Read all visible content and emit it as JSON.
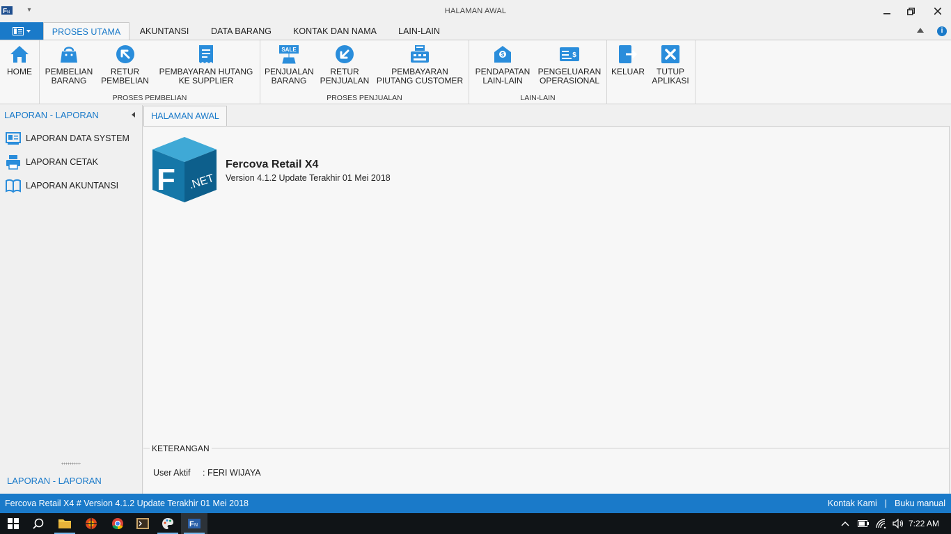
{
  "window": {
    "title": "HALAMAN AWAL",
    "controls": [
      "minimize-icon",
      "restore-icon",
      "close-icon"
    ]
  },
  "ribbon_tabs": [
    "PROSES UTAMA",
    "AKUNTANSI",
    "DATA BARANG",
    "KONTAK DAN NAMA",
    "LAIN-LAIN"
  ],
  "active_tab": "PROSES UTAMA",
  "ribbon_groups": [
    {
      "label": "",
      "buttons": [
        {
          "label": "HOME",
          "icon": "home-icon"
        }
      ]
    },
    {
      "label": "PROSES PEMBELIAN",
      "buttons": [
        {
          "label": "PEMBELIAN\nBARANG",
          "icon": "shopping-bag-icon"
        },
        {
          "label": "RETUR\nPEMBELIAN",
          "icon": "arrow-up-left-icon"
        },
        {
          "label": "PEMBAYARAN HUTANG\nKE SUPPLIER",
          "icon": "receipt-icon"
        }
      ]
    },
    {
      "label": "PROSES PENJUALAN",
      "buttons": [
        {
          "label": "PENJUALAN\nBARANG",
          "icon": "sale-tag-icon"
        },
        {
          "label": "RETUR\nPENJUALAN",
          "icon": "arrow-down-left-icon"
        },
        {
          "label": "PEMBAYARAN\nPIUTANG CUSTOMER",
          "icon": "cash-register-icon"
        }
      ]
    },
    {
      "label": "LAIN-LAIN",
      "buttons": [
        {
          "label": "PENDAPATAN\nLAIN-LAIN",
          "icon": "income-icon"
        },
        {
          "label": "PENGELUARAN\nOPERASIONAL",
          "icon": "cheque-icon"
        }
      ]
    },
    {
      "label": "",
      "buttons": [
        {
          "label": "KELUAR",
          "icon": "logout-icon"
        },
        {
          "label": "TUTUP\nAPLIKASI",
          "icon": "close-app-icon"
        }
      ]
    }
  ],
  "left_panel": {
    "title": "LAPORAN - LAPORAN",
    "items": [
      {
        "label": "LAPORAN DATA SYSTEM",
        "icon": "id-card-icon"
      },
      {
        "label": "LAPORAN CETAK",
        "icon": "printer-icon"
      },
      {
        "label": "LAPORAN AKUNTANSI",
        "icon": "book-icon"
      }
    ],
    "footer": "LAPORAN - LAPORAN"
  },
  "document": {
    "tab": "HALAMAN AWAL",
    "logo_text": ".NET",
    "product_name": "Fercova Retail X4",
    "product_version": "Version 4.1.2 Update Terakhir 01 Mei 2018",
    "info_title": "KETERANGAN",
    "user_label": "User Aktif",
    "user_value": ": FERI WIJAYA"
  },
  "statusbar": {
    "left": "Fercova Retail X4 # Version 4.1.2 Update Terakhir 01 Mei 2018",
    "link_contact": "Kontak Kami",
    "separator": "|",
    "link_manual": "Buku manual"
  },
  "taskbar": {
    "clock": "7:22 AM",
    "apps": [
      "start-icon",
      "search-icon",
      "file-explorer-icon",
      "media-app-icon",
      "chrome-icon",
      "terminal-app-icon",
      "paint-app-icon",
      "fercova-app-icon"
    ]
  },
  "colors": {
    "accent": "#1a7ac9",
    "ribbon_bg": "#f7f7f7",
    "taskbar_bg": "#101417"
  }
}
